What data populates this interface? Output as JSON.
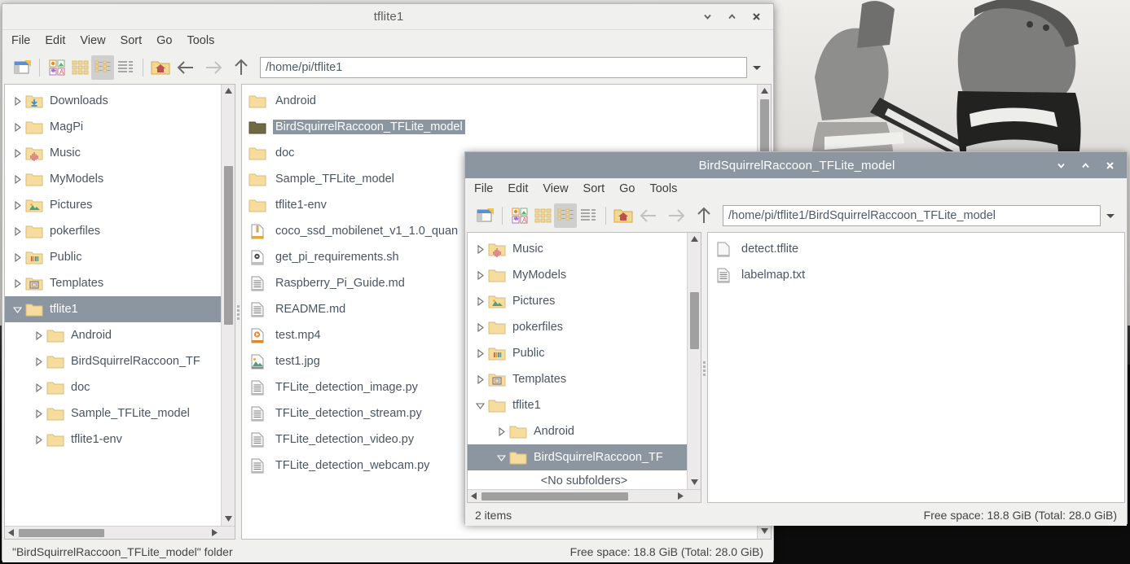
{
  "desktop": {
    "wallpaper_description": "grayscale-soldiers-photo"
  },
  "window1": {
    "title": "tflite1",
    "active": false,
    "menu": [
      "File",
      "Edit",
      "View",
      "Sort",
      "Go",
      "Tools"
    ],
    "toolbar": {
      "new_window": "new-window-icon",
      "view_thumbnail": "thumbnail-view-icon",
      "view_icon": "icon-view-icon",
      "view_compact": "compact-view-icon",
      "view_detailed": "detailed-view-icon",
      "home": "home-icon",
      "back": "back-arrow-icon",
      "forward": "forward-arrow-icon",
      "up": "up-arrow-icon",
      "dropdown": "chevron-down-icon"
    },
    "path": "/home/pi/tflite1",
    "tree": [
      {
        "label": "Downloads",
        "indent": 1,
        "icon": "downloads-folder",
        "state": "collapsed",
        "selected": false
      },
      {
        "label": "MagPi",
        "indent": 1,
        "icon": "folder",
        "state": "collapsed",
        "selected": false
      },
      {
        "label": "Music",
        "indent": 1,
        "icon": "music-folder",
        "state": "collapsed",
        "selected": false
      },
      {
        "label": "MyModels",
        "indent": 1,
        "icon": "folder",
        "state": "collapsed",
        "selected": false
      },
      {
        "label": "Pictures",
        "indent": 1,
        "icon": "pictures-folder",
        "state": "collapsed",
        "selected": false
      },
      {
        "label": "pokerfiles",
        "indent": 1,
        "icon": "folder",
        "state": "collapsed",
        "selected": false
      },
      {
        "label": "Public",
        "indent": 1,
        "icon": "public-folder",
        "state": "collapsed",
        "selected": false
      },
      {
        "label": "Templates",
        "indent": 1,
        "icon": "templates-folder",
        "state": "collapsed",
        "selected": false
      },
      {
        "label": "tflite1",
        "indent": 1,
        "icon": "folder",
        "state": "expanded",
        "selected": true
      },
      {
        "label": "Android",
        "indent": 2,
        "icon": "folder",
        "state": "collapsed",
        "selected": false
      },
      {
        "label": "BirdSquirrelRaccoon_TF",
        "indent": 2,
        "icon": "folder",
        "state": "collapsed",
        "selected": false
      },
      {
        "label": "doc",
        "indent": 2,
        "icon": "folder",
        "state": "collapsed",
        "selected": false
      },
      {
        "label": "Sample_TFLite_model",
        "indent": 2,
        "icon": "folder",
        "state": "collapsed",
        "selected": false
      },
      {
        "label": "tflite1-env",
        "indent": 2,
        "icon": "folder",
        "state": "collapsed",
        "selected": false
      }
    ],
    "files": [
      {
        "label": "Android",
        "icon": "folder",
        "selected": false
      },
      {
        "label": "BirdSquirrelRaccoon_TFLite_model",
        "icon": "folder-dark",
        "selected": true
      },
      {
        "label": "doc",
        "icon": "folder",
        "selected": false
      },
      {
        "label": "Sample_TFLite_model",
        "icon": "folder",
        "selected": false
      },
      {
        "label": "tflite1-env",
        "icon": "folder",
        "selected": false
      },
      {
        "label": "coco_ssd_mobilenet_v1_1.0_quan",
        "icon": "archive",
        "selected": false
      },
      {
        "label": "get_pi_requirements.sh",
        "icon": "script",
        "selected": false
      },
      {
        "label": "Raspberry_Pi_Guide.md",
        "icon": "text",
        "selected": false
      },
      {
        "label": "README.md",
        "icon": "text",
        "selected": false
      },
      {
        "label": "test.mp4",
        "icon": "video",
        "selected": false
      },
      {
        "label": "test1.jpg",
        "icon": "image",
        "selected": false
      },
      {
        "label": "TFLite_detection_image.py",
        "icon": "text",
        "selected": false
      },
      {
        "label": "TFLite_detection_stream.py",
        "icon": "text",
        "selected": false
      },
      {
        "label": "TFLite_detection_video.py",
        "icon": "text",
        "selected": false
      },
      {
        "label": "TFLite_detection_webcam.py",
        "icon": "text",
        "selected": false
      }
    ],
    "status_left": "\"BirdSquirrelRaccoon_TFLite_model\" folder",
    "status_right": "Free space: 18.8 GiB (Total: 28.0 GiB)"
  },
  "window2": {
    "title": "BirdSquirrelRaccoon_TFLite_model",
    "active": true,
    "menu": [
      "File",
      "Edit",
      "View",
      "Sort",
      "Go",
      "Tools"
    ],
    "toolbar": {
      "new_window": "new-window-icon",
      "view_thumbnail": "thumbnail-view-icon",
      "view_icon": "icon-view-icon",
      "view_compact": "compact-view-icon",
      "view_detailed": "detailed-view-icon",
      "home": "home-icon",
      "back": "back-arrow-icon",
      "forward": "forward-arrow-icon",
      "up": "up-arrow-icon",
      "dropdown": "chevron-down-icon"
    },
    "path": "/home/pi/tflite1/BirdSquirrelRaccoon_TFLite_model",
    "tree": [
      {
        "label": "Music",
        "indent": 1,
        "icon": "music-folder",
        "state": "collapsed",
        "selected": false
      },
      {
        "label": "MyModels",
        "indent": 1,
        "icon": "folder",
        "state": "collapsed",
        "selected": false
      },
      {
        "label": "Pictures",
        "indent": 1,
        "icon": "pictures-folder",
        "state": "collapsed",
        "selected": false
      },
      {
        "label": "pokerfiles",
        "indent": 1,
        "icon": "folder",
        "state": "collapsed",
        "selected": false
      },
      {
        "label": "Public",
        "indent": 1,
        "icon": "public-folder",
        "state": "collapsed",
        "selected": false
      },
      {
        "label": "Templates",
        "indent": 1,
        "icon": "templates-folder",
        "state": "collapsed",
        "selected": false
      },
      {
        "label": "tflite1",
        "indent": 1,
        "icon": "folder",
        "state": "expanded",
        "selected": false
      },
      {
        "label": "Android",
        "indent": 2,
        "icon": "folder",
        "state": "collapsed",
        "selected": false
      },
      {
        "label": "BirdSquirrelRaccoon_TF",
        "indent": 2,
        "icon": "folder",
        "state": "expanded",
        "selected": true
      }
    ],
    "tree_no_subfolders": "<No subfolders>",
    "files": [
      {
        "label": "detect.tflite",
        "icon": "blank",
        "selected": false
      },
      {
        "label": "labelmap.txt",
        "icon": "text",
        "selected": false
      }
    ],
    "status_left": "2 items",
    "status_right": "Free space: 18.8 GiB (Total: 28.0 GiB)"
  },
  "colors": {
    "active_titlebar": "#8b96a1",
    "selection": "#8b96a1",
    "chrome": "#f0f0ef",
    "folder": "#f6dd9e",
    "text": "#4a5563"
  }
}
